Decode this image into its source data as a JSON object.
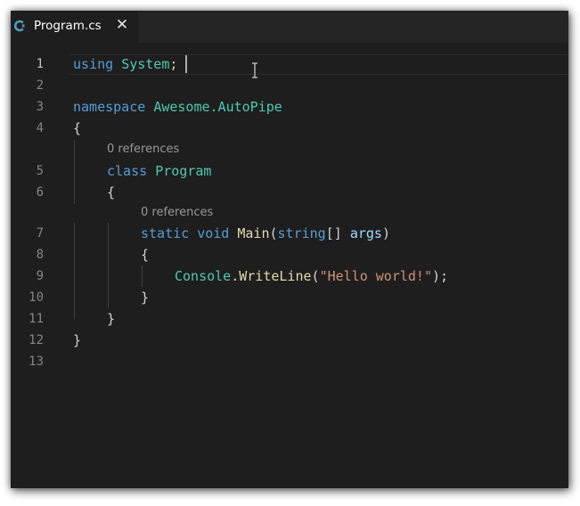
{
  "tab": {
    "filename": "Program.cs",
    "close_glyph": "✕",
    "icon": "csharp-file-icon",
    "icon_color": "#519aba"
  },
  "editor": {
    "line_numbers": [
      "1",
      "2",
      "3",
      "4",
      "5",
      "6",
      "7",
      "8",
      "9",
      "10",
      "11",
      "12",
      "13"
    ],
    "active_line": "1",
    "codelens": {
      "class_refs": "0 references",
      "method_refs": "0 references"
    },
    "code": {
      "l1_using": "using",
      "l1_ns": "System",
      "l1_semi": ";",
      "l3_namespace": "namespace",
      "l3_name": "Awesome.AutoPipe",
      "l4_brace": "{",
      "l5_class": "class",
      "l5_name": "Program",
      "l6_brace": "{",
      "l7_static": "static",
      "l7_void": "void",
      "l7_main": "Main",
      "l7_open": "(",
      "l7_string": "string",
      "l7_arr": "[]",
      "l7_args": "args",
      "l7_close": ")",
      "l8_brace": "{",
      "l9_console": "Console",
      "l9_dot": ".",
      "l9_writeline": "WriteLine",
      "l9_open": "(",
      "l9_str": "\"Hello world!\"",
      "l9_close": ");",
      "l10_brace": "}",
      "l11_brace": "}",
      "l12_brace": "}"
    }
  },
  "colors": {
    "background": "#1e1e1e",
    "keyword": "#569cd6",
    "type": "#4ec9b0",
    "function": "#dcdcaa",
    "string": "#ce9178",
    "parameter": "#9cdcfe",
    "text": "#d4d4d4"
  }
}
